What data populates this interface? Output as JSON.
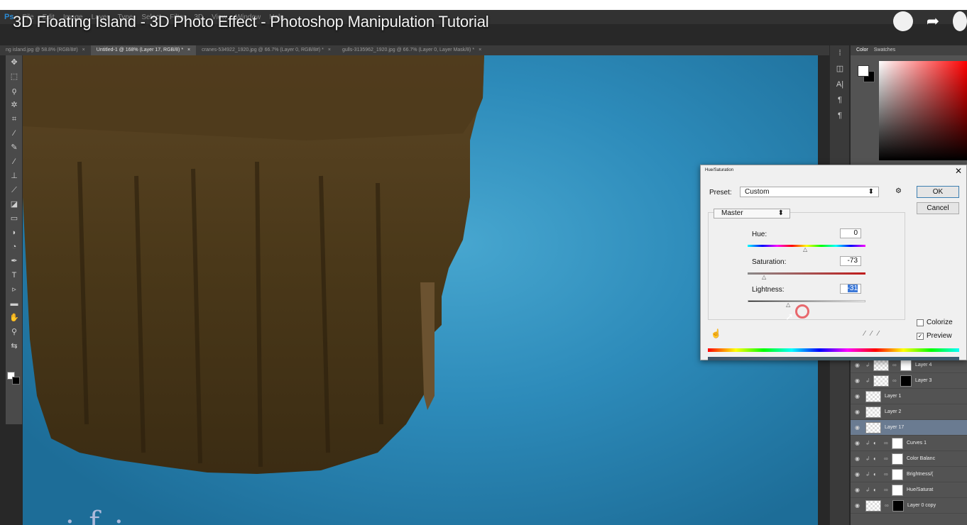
{
  "app": {
    "menu": [
      "File",
      "Edit",
      "Image",
      "Layer",
      "Type",
      "Select",
      "Filter",
      "3D",
      "View",
      "Window",
      "Help"
    ],
    "logo": "Ps"
  },
  "video": {
    "title": "3D Floating Island - 3D Photo Effect - Photoshop Manipulation Tutorial"
  },
  "tabs": [
    {
      "label": "ng island.jpg @ 58.8% (RGB/8#)",
      "close": "×"
    },
    {
      "label": "Untitled-1 @ 168% (Layer 17, RGB/8) *",
      "close": "×",
      "active": true
    },
    {
      "label": "cranes-534922_1920.jpg @ 66.7% (Layer 0, RGB/8#) *",
      "close": "×"
    },
    {
      "label": "gulls-3135962_1920.jpg @ 66.7% (Layer 0, Layer Mask/8) *",
      "close": "×"
    }
  ],
  "color_panel": {
    "tabs": [
      "Color",
      "Swatches"
    ]
  },
  "dialog": {
    "title": "Hue/Saturation",
    "close": "✕",
    "preset_label": "Preset:",
    "preset_value": "Custom",
    "ok": "OK",
    "cancel": "Cancel",
    "channel": "Master",
    "hue_label": "Hue:",
    "hue_value": "0",
    "saturation_label": "Saturation:",
    "saturation_value": "-73",
    "lightness_label": "Lightness:",
    "lightness_value": "-31",
    "colorize_label": "Colorize",
    "colorize_checked": false,
    "preview_label": "Preview",
    "preview_checked": true
  },
  "layers": [
    {
      "name": "Layer 4",
      "clipped": true,
      "mask": "white"
    },
    {
      "name": "Layer 3",
      "clipped": true,
      "mask": "black"
    },
    {
      "name": "Layer 1"
    },
    {
      "name": "Layer 2"
    },
    {
      "name": "Layer 17",
      "selected": true
    },
    {
      "name": "Curves 1",
      "clipped": true,
      "adjustment": true
    },
    {
      "name": "Color Balanc",
      "clipped": true,
      "adjustment": true
    },
    {
      "name": "Brightness/(",
      "clipped": true,
      "adjustment": true
    },
    {
      "name": "Hue/Saturat",
      "clipped": true,
      "adjustment": true
    },
    {
      "name": "Layer 0 copy"
    }
  ]
}
